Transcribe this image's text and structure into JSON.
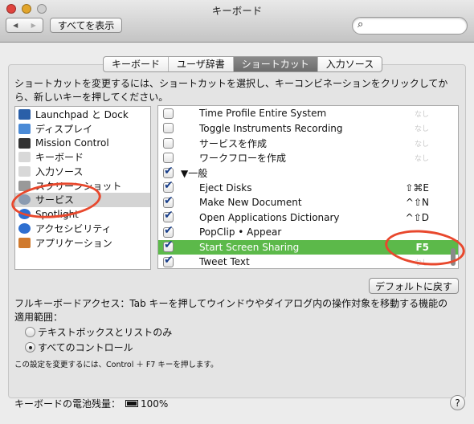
{
  "window": {
    "title": "キーボード"
  },
  "toolbar": {
    "back": "◀",
    "forward": "▶",
    "show_all": "すべてを表示",
    "search_placeholder": ""
  },
  "tabs": [
    {
      "label": "キーボード"
    },
    {
      "label": "ユーザ辞書"
    },
    {
      "label": "ショートカット",
      "selected": true
    },
    {
      "label": "入力ソース"
    }
  ],
  "description": "ショートカットを変更するには、ショートカットを選択し、キーコンビネーションをクリックしてから、新しいキーを押してください。",
  "categories": [
    {
      "label": "Launchpad と Dock",
      "icon": "launchpad-icon",
      "color": "#2a5fa8"
    },
    {
      "label": "ディスプレイ",
      "icon": "display-icon",
      "color": "#4a8ad6"
    },
    {
      "label": "Mission Control",
      "icon": "mission-control-icon",
      "color": "#333333"
    },
    {
      "label": "キーボード",
      "icon": "keyboard-icon",
      "color": "#d8d8d8"
    },
    {
      "label": "入力ソース",
      "icon": "keyboard-icon",
      "color": "#d8d8d8"
    },
    {
      "label": "スクリーンショット",
      "icon": "screenshot-icon",
      "color": "#999999"
    },
    {
      "label": "サービス",
      "icon": "gear-icon",
      "color": "#8a9ab0",
      "selected": true
    },
    {
      "label": "Spotlight",
      "icon": "spotlight-icon",
      "color": "#2e6fd0"
    },
    {
      "label": "アクセシビリティ",
      "icon": "accessibility-icon",
      "color": "#2e6fd0"
    },
    {
      "label": "アプリケーション",
      "icon": "app-store-icon",
      "color": "#d07a2e"
    }
  ],
  "shortcuts": [
    {
      "label": "Time Profile Entire System",
      "key": "なし",
      "checked": false
    },
    {
      "label": "Toggle Instruments Recording",
      "key": "なし",
      "checked": false
    },
    {
      "label": "サービスを作成",
      "key": "なし",
      "checked": false
    },
    {
      "label": "ワークフローを作成",
      "key": "なし",
      "checked": false
    },
    {
      "label": "▼一般",
      "key": "",
      "checked": true,
      "group": true
    },
    {
      "label": "Eject Disks",
      "key": "⇧⌘E",
      "checked": true
    },
    {
      "label": "Make New Document",
      "key": "^⇧N",
      "checked": true
    },
    {
      "label": "Open Applications Dictionary",
      "key": "^⇧D",
      "checked": true
    },
    {
      "label": "PopClip • Appear",
      "key": "",
      "checked": true
    },
    {
      "label": "Start Screen Sharing",
      "key": "F5",
      "checked": true,
      "selected": true
    },
    {
      "label": "Tweet Text",
      "key": "なし",
      "checked": true
    }
  ],
  "restore_defaults": "デフォルトに戻す",
  "full_keyboard_access": {
    "text": "フルキーボードアクセス：Tab キーを押してウインドウやダイアログ内の操作対象を移動する機能の適用範囲：",
    "options": [
      {
        "label": "テキストボックスとリストのみ",
        "selected": false
      },
      {
        "label": "すべてのコントロール",
        "selected": true
      }
    ],
    "note": "この設定を変更するには、Control ＋ F7 キーを押します。"
  },
  "battery": {
    "label": "キーボードの電池残量：",
    "value": "100%",
    "level": 1.0
  },
  "help": "?",
  "colors": {
    "selection": "#5cb94a",
    "annotation": "#e8482d"
  }
}
